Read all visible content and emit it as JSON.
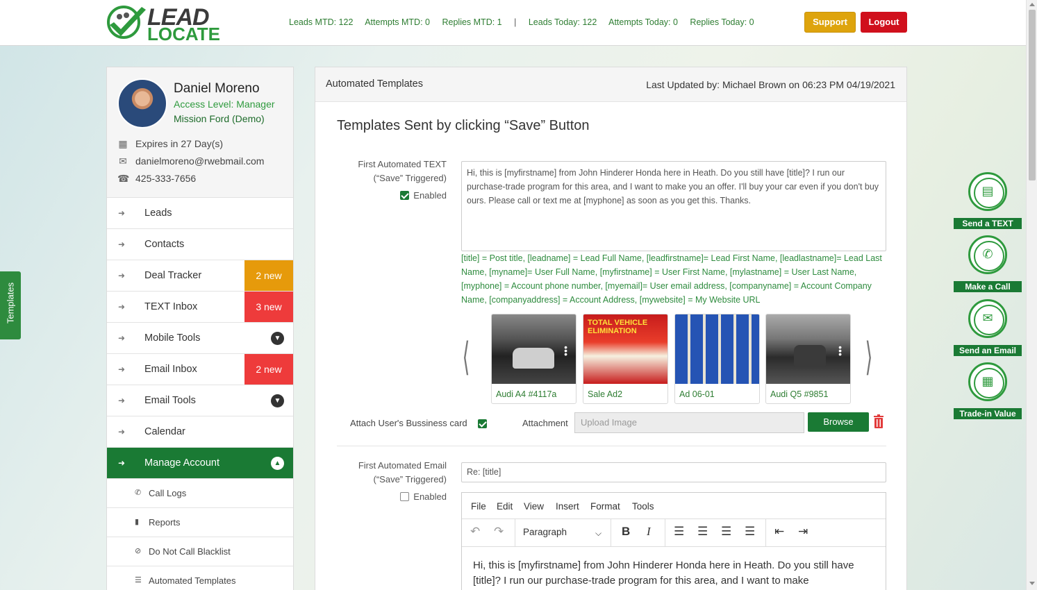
{
  "header": {
    "logo_top": "LEAD",
    "logo_bottom": "LOCATE",
    "stats": {
      "leads_mtd": "Leads MTD: 122",
      "attempts_mtd": "Attempts MTD: 0",
      "replies_mtd": "Replies MTD: 1",
      "separator": "|",
      "leads_today": "Leads Today: 122",
      "attempts_today": "Attempts Today: 0",
      "replies_today": "Replies Today: 0"
    },
    "support_label": "Support",
    "logout_label": "Logout",
    "colors": {
      "support": "#dea40d",
      "logout": "#d0101c",
      "brand_green": "#1a7a34"
    }
  },
  "side_tab": {
    "label": "Templates"
  },
  "profile": {
    "name": "Daniel Moreno",
    "access": "Access Level: Manager",
    "dealer": "Mission Ford (Demo)",
    "expires": "Expires in 27 Day(s)",
    "email": "danielmoreno@rwebmail.com",
    "phone": "425-333-7656"
  },
  "menu": {
    "items": [
      {
        "label": "Leads"
      },
      {
        "label": "Contacts"
      },
      {
        "label": "Deal Tracker",
        "badge": "2 new"
      },
      {
        "label": "TEXT Inbox",
        "badge": "3 new"
      },
      {
        "label": "Mobile Tools"
      },
      {
        "label": "Email Inbox",
        "badge": "2 new"
      },
      {
        "label": "Email Tools"
      },
      {
        "label": "Calendar"
      },
      {
        "label": "Manage Account"
      }
    ],
    "sub_items": [
      {
        "label": "Call Logs"
      },
      {
        "label": "Reports"
      },
      {
        "label": "Do Not Call Blacklist"
      },
      {
        "label": "Automated Templates"
      }
    ]
  },
  "panel": {
    "title": "Automated Templates",
    "updated": "Last Updated by: Michael Brown on 06:23 PM 04/19/2021",
    "section_title": "Templates Sent by clicking “Save” Button",
    "text_template": {
      "label_line1": "First Automated TEXT",
      "label_line2": "(“Save” Triggered)",
      "enabled_label": "Enabled",
      "enabled": true,
      "body": "Hi, this is [myfirstname] from John Hinderer Honda here in Heath. Do you still have [title]? I run our purchase-trade program for this area, and I want to make you an offer. I'll buy your car even if you don't buy ours. Please call or text me at [myphone] as soon as you get this. Thanks.",
      "help": "[title] = Post title, [leadname] = Lead Full Name, [leadfirstname]= Lead First Name, [leadlastname]= Lead Last Name, [myname]= User Full Name, [myfirstname] = User First Name, [mylastname] = User Last Name, [myphone] = Account phone number, [myemail]= User email address, [companyname] = Account Company Name, [companyaddress] = Account Address, [mywebsite] = My Website URL"
    },
    "carousel": {
      "cards": [
        {
          "caption": "Audi A4 #4117a"
        },
        {
          "caption": "Sale Ad2",
          "ad_text": "TOTAL VEHICLE ELIMINATION"
        },
        {
          "caption": "Ad 06-01"
        },
        {
          "caption": "Audi Q5 #9851"
        }
      ]
    },
    "attach_card_label": "Attach User's Bussiness card",
    "attach_card_checked": true,
    "attachment_label": "Attachment",
    "upload_placeholder": "Upload Image",
    "browse_label": "Browse",
    "email_template": {
      "label_line1": "First Automated Email",
      "label_line2": "(“Save” Triggered)",
      "enabled_label": "Enabled",
      "enabled": false,
      "subject": "Re: [title]",
      "menu": [
        "File",
        "Edit",
        "View",
        "Insert",
        "Format",
        "Tools"
      ],
      "block_format": "Paragraph",
      "body": "Hi, this is [myfirstname] from John Hinderer Honda here in Heath. Do you still have [title]? I run our purchase-trade program for this area, and I want to make"
    }
  },
  "actions": [
    {
      "label": "Send a TEXT"
    },
    {
      "label": "Make a Call"
    },
    {
      "label": "Send an Email"
    },
    {
      "label": "Trade-in Value"
    }
  ]
}
